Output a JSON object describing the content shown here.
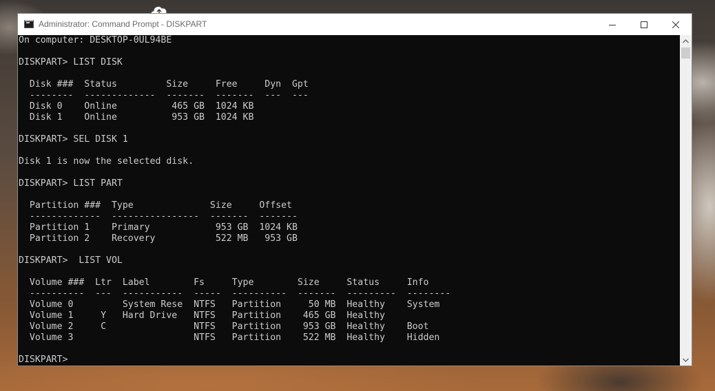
{
  "window": {
    "title": "Administrator: Command Prompt - DISKPART"
  },
  "titlebar_icons": {
    "app": "console-icon",
    "minimize": "minimize-icon",
    "maximize": "maximize-icon",
    "close": "close-icon"
  },
  "console": {
    "lines": [
      "On computer: DESKTOP-0UL94BE",
      "",
      "DISKPART> LIST DISK",
      "",
      "  Disk ###  Status         Size     Free     Dyn  Gpt",
      "  --------  -------------  -------  -------  ---  ---",
      "  Disk 0    Online          465 GB  1024 KB",
      "  Disk 1    Online          953 GB  1024 KB",
      "",
      "DISKPART> SEL DISK 1",
      "",
      "Disk 1 is now the selected disk.",
      "",
      "DISKPART> LIST PART",
      "",
      "  Partition ###  Type              Size     Offset",
      "  -------------  ----------------  -------  -------",
      "  Partition 1    Primary            953 GB  1024 KB",
      "  Partition 2    Recovery           522 MB   953 GB",
      "",
      "DISKPART>  LIST VOL",
      "",
      "  Volume ###  Ltr  Label        Fs     Type        Size     Status     Info",
      "  ----------  ---  -----------  -----  ----------  -------  ---------  --------",
      "  Volume 0         System Rese  NTFS   Partition     50 MB  Healthy    System",
      "  Volume 1     Y   Hard Drive   NTFS   Partition    465 GB  Healthy",
      "  Volume 2     C                NTFS   Partition    953 GB  Healthy    Boot",
      "  Volume 3                      NTFS   Partition    522 MB  Healthy    Hidden",
      "",
      "DISKPART> "
    ]
  },
  "colors": {
    "console_bg": "#0c0c0c",
    "console_text": "#cccccc",
    "titlebar_bg": "#ffffff"
  }
}
